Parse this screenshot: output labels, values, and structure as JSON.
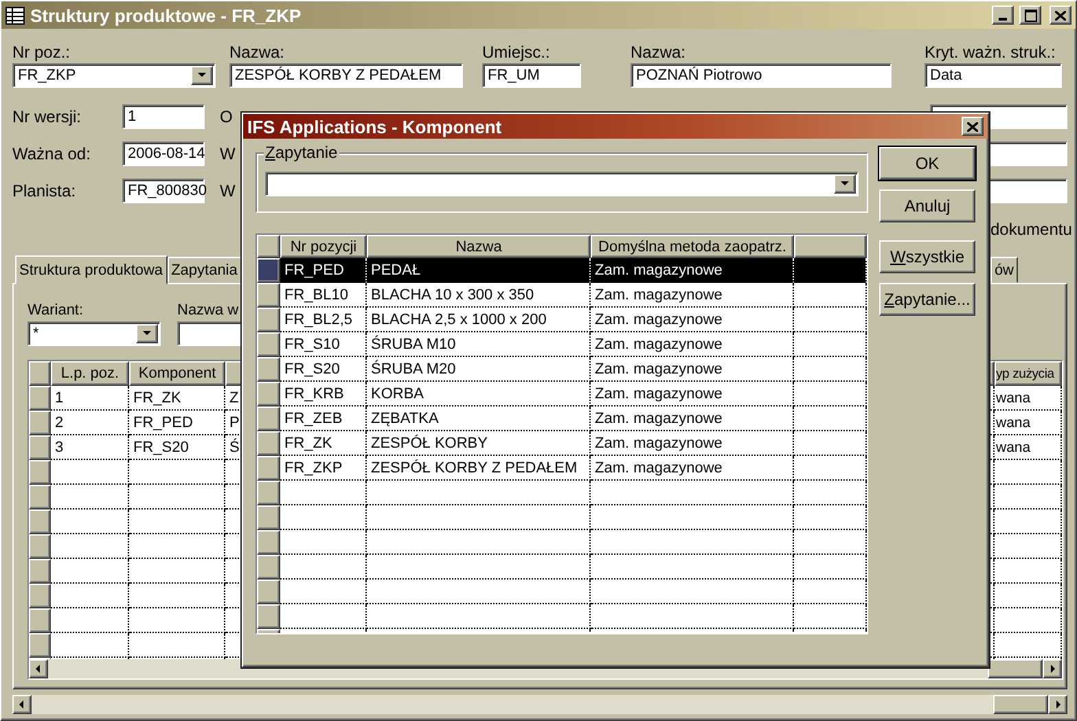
{
  "window": {
    "title": "Struktury produktowe - FR_ZKP"
  },
  "top_fields": [
    {
      "label": "Nr poz.:",
      "value": "FR_ZKP",
      "kind": "combo"
    },
    {
      "label": "Nazwa:",
      "value": "ZESPÓŁ KORBY Z PEDAŁEM",
      "kind": "text"
    },
    {
      "label": "Umiejsc.:",
      "value": "FR_UM",
      "kind": "text"
    },
    {
      "label": "Nazwa:",
      "value": "POZNAŃ Piotrowo",
      "kind": "text"
    },
    {
      "label": "Kryt. ważn. struk.:",
      "value": "Data",
      "kind": "text"
    }
  ],
  "left_fields": [
    {
      "label": "Nr wersji:",
      "value": "1",
      "column_2_label": "O"
    },
    {
      "label": "Ważna od:",
      "value": "2006-08-14",
      "column_2_label": "W"
    },
    {
      "label": "Planista:",
      "value": "FR_800830",
      "column_2_label": "W"
    }
  ],
  "right_note": "dokumentu",
  "tabs": [
    {
      "label": "Struktura produktowa",
      "selected": true
    },
    {
      "label": "Zapytania",
      "selected": false
    },
    {
      "label": "ów",
      "selected": false
    }
  ],
  "variant": {
    "label": "Wariant:",
    "value": "*"
  },
  "name_field": {
    "label": "Nazwa w"
  },
  "table": {
    "columns": [
      "L.p. poz.",
      "Komponent",
      "",
      "yp zużycia"
    ],
    "rows": [
      {
        "cells": [
          "1",
          "FR_ZK",
          "Z",
          "wana"
        ]
      },
      {
        "cells": [
          "2",
          "FR_PED",
          "P",
          "wana"
        ]
      },
      {
        "cells": [
          "3",
          "FR_S20",
          "Ś",
          "wana"
        ]
      }
    ]
  },
  "dialog": {
    "title": "IFS Applications - Komponent",
    "query_group": {
      "label": "Zapytanie",
      "mnemonic": true
    },
    "buttons": [
      {
        "label": "OK",
        "default": true
      },
      {
        "label": "Anuluj",
        "default": false
      },
      {
        "label": "Wszystkie",
        "default": false,
        "mnemonic": true
      },
      {
        "label": "Zapytanie...",
        "default": false,
        "mnemonic": true
      }
    ],
    "grid": {
      "columns": [
        "Nr pozycji",
        "Nazwa",
        "Domyślna metoda zaopatrz."
      ],
      "rows": [
        {
          "cells": [
            "FR_PED",
            "PEDAŁ",
            "Zam. magazynowe"
          ],
          "selected": true
        },
        {
          "cells": [
            "FR_BL10",
            "BLACHA 10 x 300 x 350",
            "Zam. magazynowe"
          ],
          "selected": false
        },
        {
          "cells": [
            "FR_BL2,5",
            "BLACHA 2,5 x 1000 x 200",
            "Zam. magazynowe"
          ],
          "selected": false
        },
        {
          "cells": [
            "FR_S10",
            "ŚRUBA M10",
            "Zam. magazynowe"
          ],
          "selected": false
        },
        {
          "cells": [
            "FR_S20",
            "ŚRUBA M20",
            "Zam. magazynowe"
          ],
          "selected": false
        },
        {
          "cells": [
            "FR_KRB",
            "KORBA",
            "Zam. magazynowe"
          ],
          "selected": false
        },
        {
          "cells": [
            "FR_ZEB",
            "ZĘBATKA",
            "Zam. magazynowe"
          ],
          "selected": false
        },
        {
          "cells": [
            "FR_ZK",
            "ZESPÓŁ KORBY",
            "Zam. magazynowe"
          ],
          "selected": false
        },
        {
          "cells": [
            "FR_ZKP",
            "ZESPÓŁ KORBY Z PEDAŁEM",
            "Zam. magazynowe"
          ],
          "selected": false
        }
      ]
    }
  }
}
